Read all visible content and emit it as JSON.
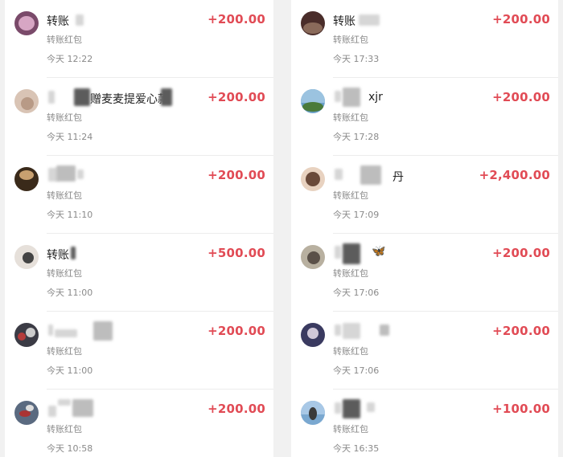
{
  "colors": {
    "amount": "#e14b55",
    "meta": "#8a8a8a",
    "title": "#222222"
  },
  "left": [
    {
      "title": "转账",
      "subtitle": "转账红包",
      "time": "今天 12:22",
      "amount": "+200.00"
    },
    {
      "title": "赠麦麦提爱心款",
      "subtitle": "转账红包",
      "time": "今天 11:24",
      "amount": "+200.00"
    },
    {
      "title": "",
      "subtitle": "转账红包",
      "time": "今天 11:10",
      "amount": "+200.00"
    },
    {
      "title": "转账",
      "subtitle": "转账红包",
      "time": "今天 11:00",
      "amount": "+500.00"
    },
    {
      "title": "",
      "subtitle": "转账红包",
      "time": "今天 11:00",
      "amount": "+200.00"
    },
    {
      "title": "",
      "subtitle": "转账红包",
      "time": "今天 10:58",
      "amount": "+200.00"
    }
  ],
  "right": [
    {
      "title": "转账",
      "subtitle": "转账红包",
      "time": "今天 17:33",
      "amount": "+200.00"
    },
    {
      "title": "xjr",
      "subtitle": "转账红包",
      "time": "今天 17:28",
      "amount": "+200.00"
    },
    {
      "title": "丹",
      "subtitle": "转账红包",
      "time": "今天 17:09",
      "amount": "+2,400.00"
    },
    {
      "title": "",
      "subtitle": "转账红包",
      "time": "今天 17:06",
      "amount": "+200.00"
    },
    {
      "title": "",
      "subtitle": "转账红包",
      "time": "今天 17:06",
      "amount": "+200.00"
    },
    {
      "title": "",
      "subtitle": "转账红包",
      "time": "今天 16:35",
      "amount": "+100.00"
    }
  ]
}
